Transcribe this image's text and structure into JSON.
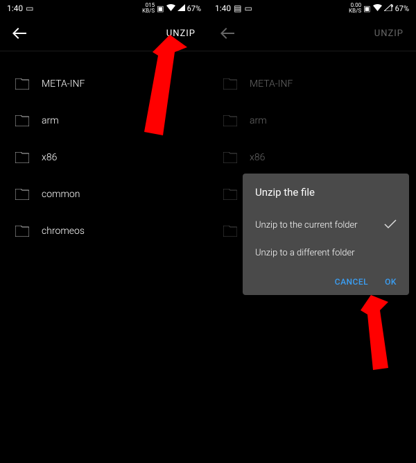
{
  "statusBar": {
    "time": "1:40",
    "battery": "67%",
    "kbs_left": "015",
    "kbs_right": "0.00",
    "kbs_label": "KB/S"
  },
  "header": {
    "unzip_label": "UNZIP"
  },
  "folders": [
    {
      "name": "META-INF"
    },
    {
      "name": "arm"
    },
    {
      "name": "x86"
    },
    {
      "name": "common"
    },
    {
      "name": "chromeos"
    }
  ],
  "dialog": {
    "title": "Unzip the file",
    "option1": "Unzip to the current folder",
    "option2": "Unzip to a different folder",
    "cancel": "CANCEL",
    "ok": "OK"
  }
}
